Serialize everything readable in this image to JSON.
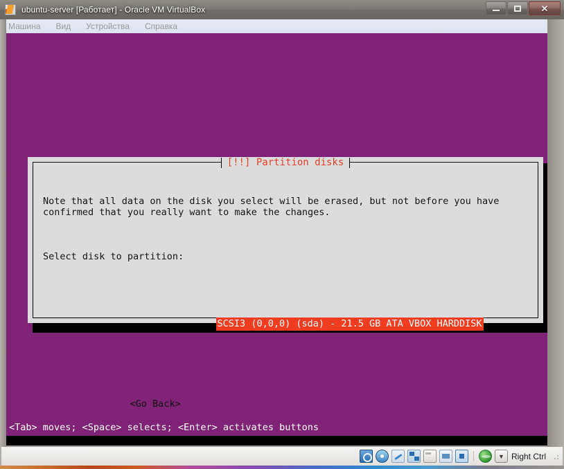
{
  "window": {
    "title": "ubuntu-server [Работает] - Oracle VM VirtualBox",
    "app_icon": "virtualbox-icon",
    "controls": {
      "minimize": "–",
      "maximize": "□",
      "close": "✕"
    }
  },
  "menubar": {
    "items": [
      {
        "label": "Машина"
      },
      {
        "label": "Вид"
      },
      {
        "label": "Устройства"
      },
      {
        "label": "Справка"
      }
    ]
  },
  "guest": {
    "background_color": "#802277",
    "dialog": {
      "title": "[!!] Partition disks",
      "title_color": "#e8412a",
      "background_color": "#dcdcdc",
      "note": "Note that all data on the disk you select will be erased, but not before you have\nconfirmed that you really want to make the changes.",
      "prompt": "Select disk to partition:",
      "disks": [
        {
          "label": "SCSI3 (0,0,0) (sda) - 21.5 GB ATA VBOX HARDDISK",
          "selected": true,
          "highlight_bg": "#f03d22",
          "highlight_fg": "#ffffff"
        }
      ],
      "buttons": [
        {
          "label": "<Go Back>"
        }
      ]
    },
    "help_line": "<Tab> moves; <Space> selects; <Enter> activates buttons"
  },
  "statusbar": {
    "icons": [
      {
        "name": "hard-disk-icon"
      },
      {
        "name": "optical-drive-icon"
      },
      {
        "name": "usb-icon"
      },
      {
        "name": "network-icon"
      },
      {
        "name": "shared-folders-icon"
      },
      {
        "name": "display-icon"
      },
      {
        "name": "cpu-icon"
      }
    ],
    "extra_icons": [
      {
        "name": "remote-display-icon"
      },
      {
        "name": "host-key-icon"
      }
    ],
    "host_key_label": "Right Ctrl"
  }
}
